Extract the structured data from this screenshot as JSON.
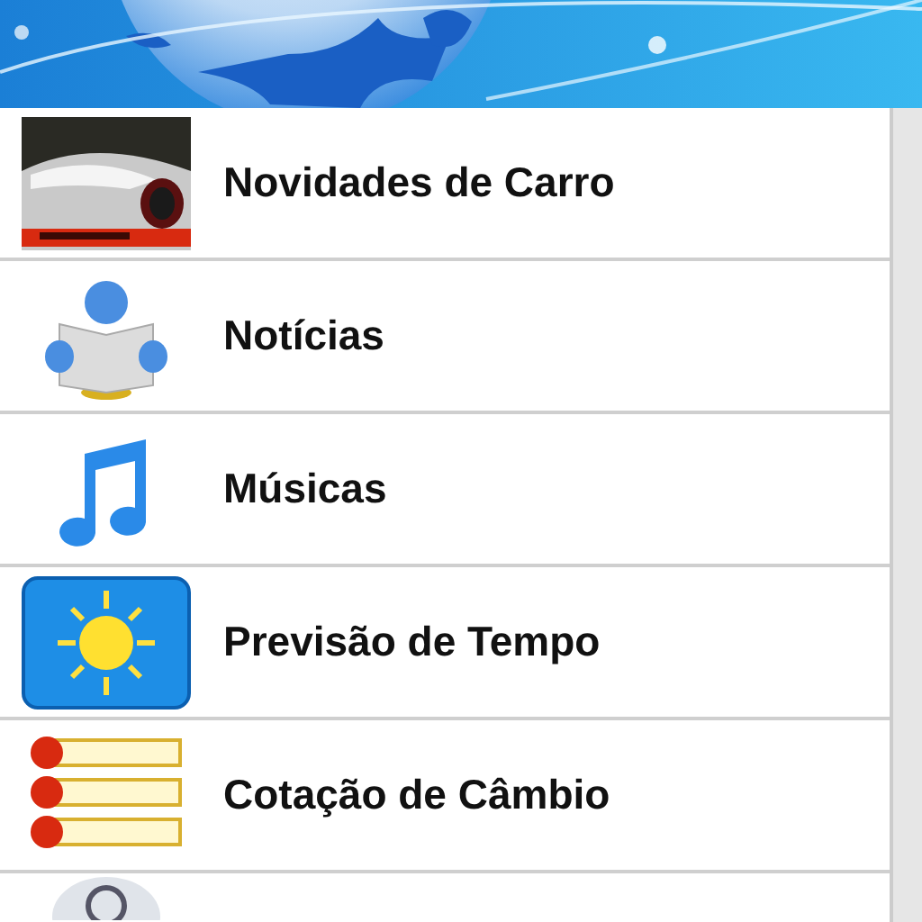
{
  "menu_items": [
    {
      "kind": "car",
      "label": "Novidades de Carro"
    },
    {
      "kind": "news",
      "label": "Notícias"
    },
    {
      "kind": "music",
      "label": "Músicas"
    },
    {
      "kind": "weather",
      "label": "Previsão de Tempo"
    },
    {
      "kind": "currency",
      "label": "Cotação de Câmbio"
    },
    {
      "kind": "email"
    }
  ]
}
